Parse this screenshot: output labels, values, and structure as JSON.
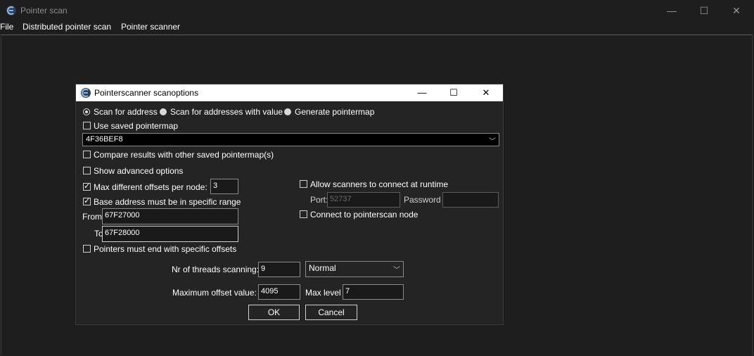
{
  "window": {
    "title": "Pointer scan",
    "controls": {
      "minimize": "—",
      "maximize": "☐",
      "close": "✕"
    }
  },
  "menu": {
    "items": [
      "File",
      "Distributed pointer scan",
      "Pointer scanner"
    ]
  },
  "dialog": {
    "title": "Pointerscanner scanoptions",
    "controls": {
      "minimize": "—",
      "maximize": "☐",
      "close": "✕"
    },
    "scan_mode": {
      "options": [
        "Scan for address",
        "Scan for addresses with value",
        "Generate pointermap"
      ],
      "selected_index": 0
    },
    "use_saved_pointermap": {
      "label": "Use saved pointermap",
      "checked": false
    },
    "address_combo": {
      "value": "4F36BEF8"
    },
    "compare_results": {
      "label": "Compare results with other saved pointermap(s)",
      "checked": false
    },
    "show_advanced": {
      "label": "Show advanced options",
      "checked": false
    },
    "max_offsets": {
      "label": "Max different offsets per node:",
      "checked": true,
      "value": "3"
    },
    "base_range": {
      "label": "Base address must be in specific range",
      "checked": true
    },
    "from": {
      "label": "From",
      "value": "67F27000"
    },
    "to": {
      "label": "To",
      "value": "67F28000"
    },
    "pointers_end": {
      "label": "Pointers must end with specific offsets",
      "checked": false
    },
    "allow_scanners": {
      "label": "Allow scanners to connect at runtime",
      "checked": false
    },
    "port": {
      "label": "Port:",
      "value": "52737"
    },
    "password": {
      "label": "Password",
      "value": ""
    },
    "connect_node": {
      "label": "Connect to pointerscan node",
      "checked": false
    },
    "threads": {
      "label": "Nr of threads scanning:",
      "value": "9",
      "priority": "Normal"
    },
    "max_offset_value": {
      "label": "Maximum offset value:",
      "value": "4095"
    },
    "max_level": {
      "label": "Max level",
      "value": "7"
    },
    "ok_label": "OK",
    "cancel_label": "Cancel"
  },
  "colors": {
    "background": "#1e1e1e",
    "dialog_background": "#242424",
    "dialog_titlebar": "#ffffff"
  }
}
